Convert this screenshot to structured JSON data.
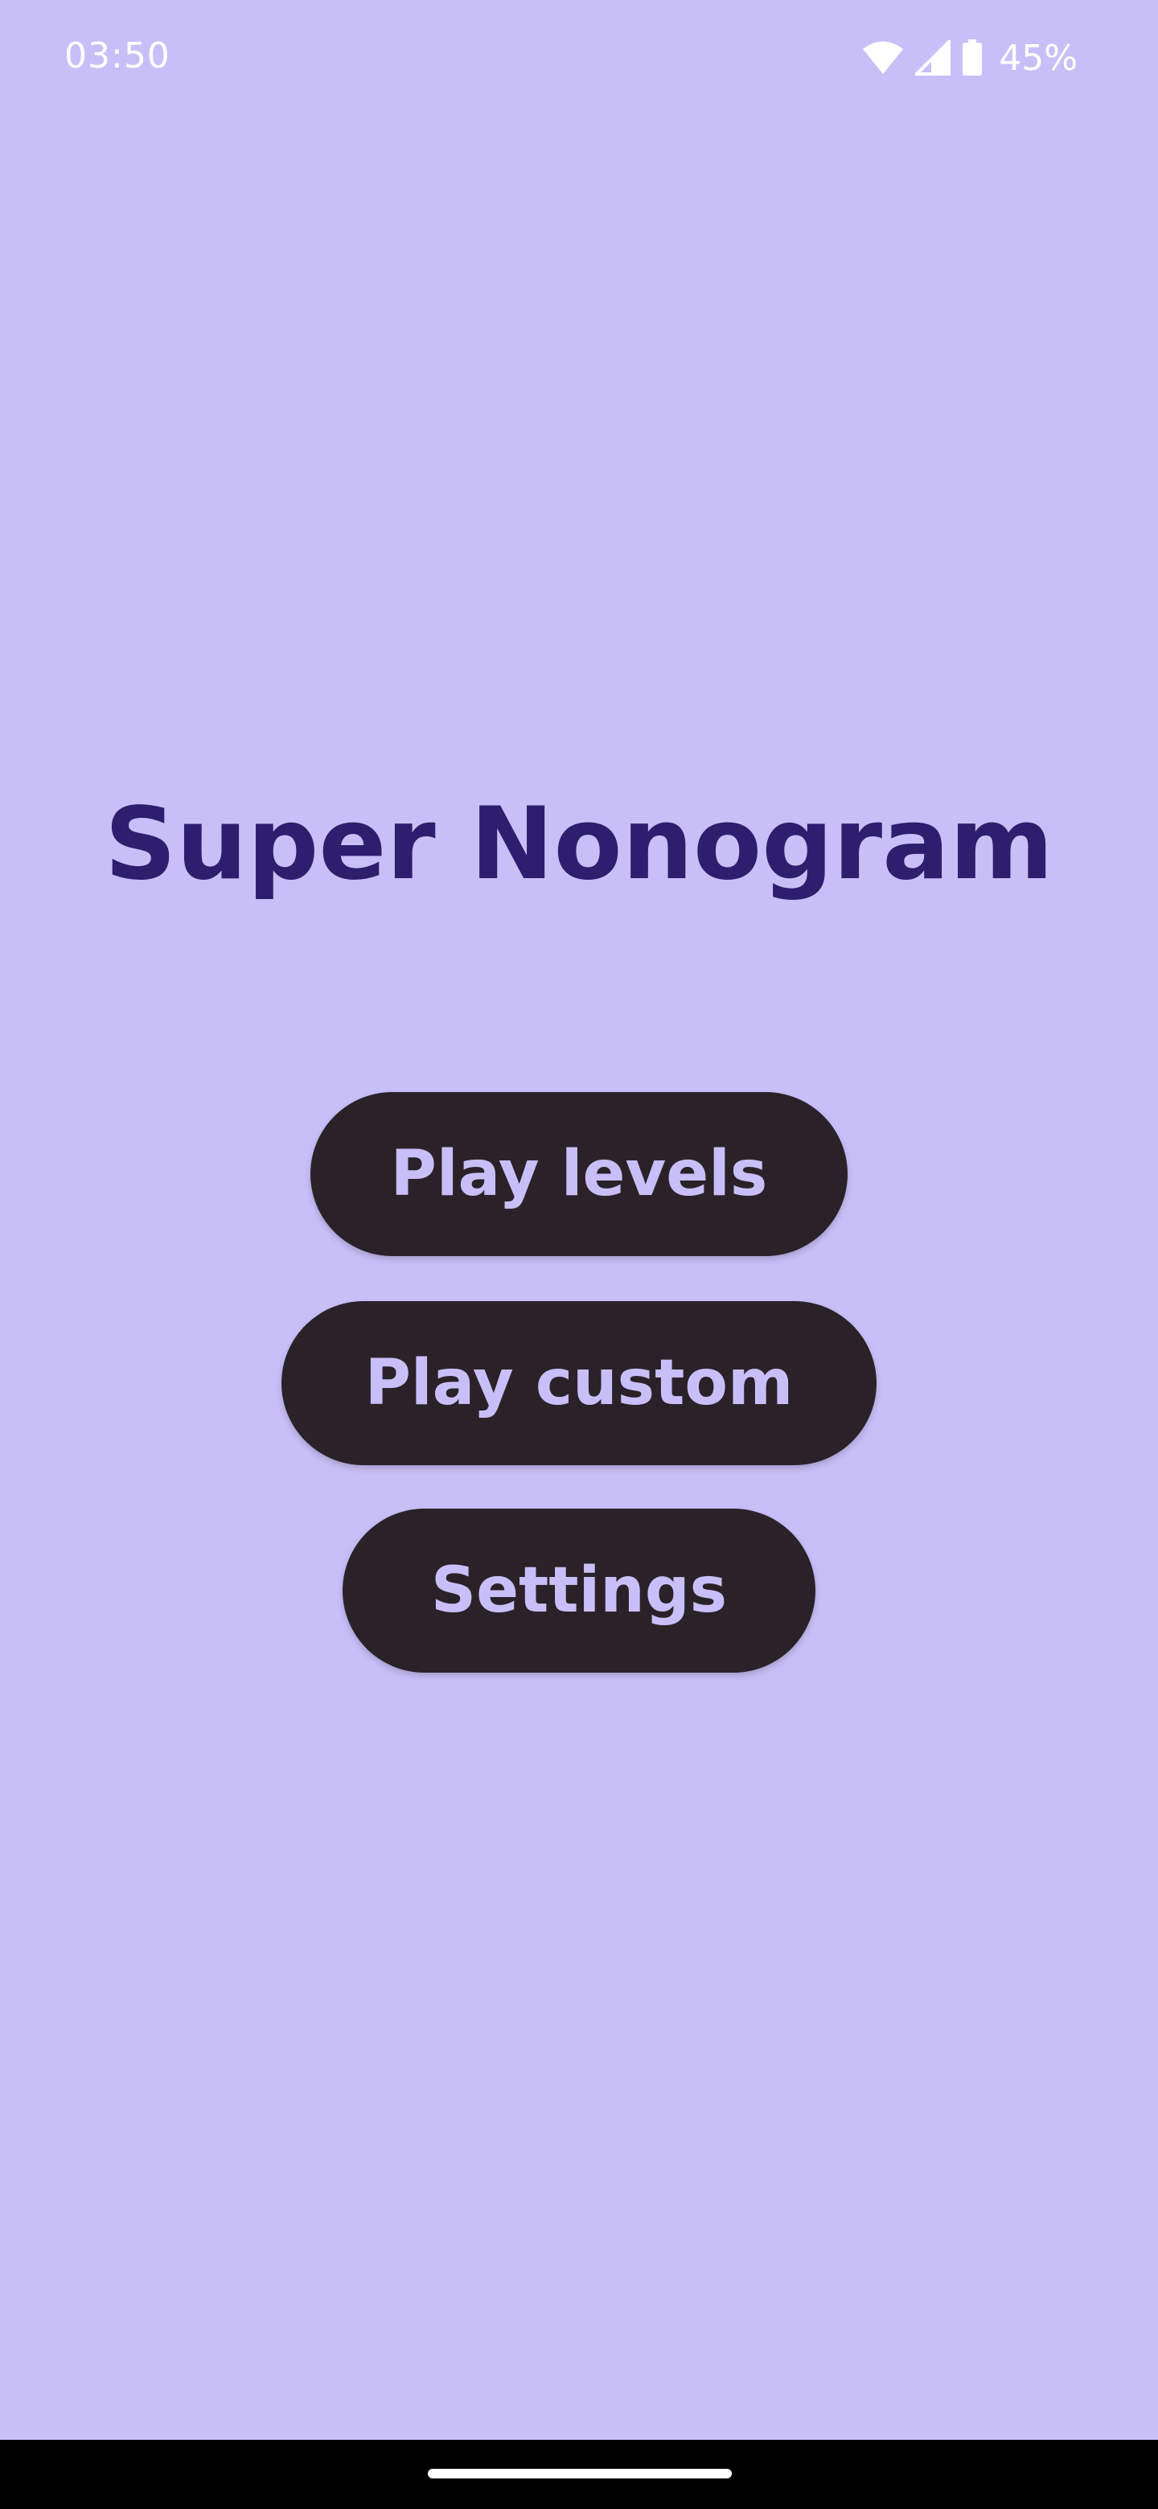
{
  "status_bar": {
    "time": "03:50",
    "battery_percent": "45%",
    "icons": [
      "wifi-icon",
      "cell-signal-icon",
      "battery-icon"
    ]
  },
  "main": {
    "title": "Super Nonogram",
    "buttons": [
      {
        "label": "Play levels"
      },
      {
        "label": "Play custom"
      },
      {
        "label": "Settings"
      }
    ]
  },
  "colors": {
    "background": "#c9bff8",
    "title": "#2d1f6e",
    "button_bg": "#2b2229",
    "button_text": "#c9bff8"
  }
}
